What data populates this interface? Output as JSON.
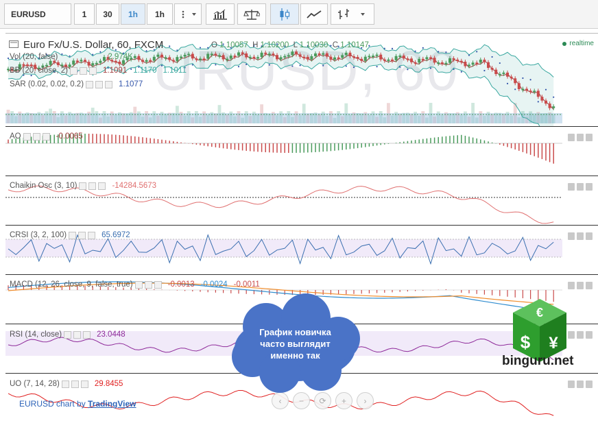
{
  "toolbar": {
    "symbol": "EURUSD",
    "intervals": [
      "1",
      "30",
      "1h",
      "1h"
    ],
    "active_interval_index": 2
  },
  "main": {
    "title": "Euro Fx/U.S. Dollar, 60, FXCM",
    "watermark": "URUSD, 60",
    "ohlc": {
      "o_label": "O",
      "o": "1.10057",
      "h_label": "H",
      "h": "1.10200",
      "l_label": "L",
      "l": "1.10030",
      "c_label": "C",
      "c": "1.10147"
    },
    "realtime": "realtime",
    "vol_label": "Vol (20, false)",
    "vol_value": "2.974K",
    "bb_label": "BB (20, close, 2)",
    "bb_values": [
      "1.1091",
      "1.1170",
      "1.1011"
    ],
    "sar_label": "SAR (0.02, 0.02, 0.2)",
    "sar_value": "1.1077"
  },
  "indicators": {
    "ao": {
      "label": "AO",
      "value": "-0.0065"
    },
    "chaikin": {
      "label": "Chaikin Osc (3, 10)",
      "value": "-14284.5673"
    },
    "crsi": {
      "label": "CRSI (3, 2, 100)",
      "value": "65.6972"
    },
    "macd": {
      "label": "MACD (12, 26, close, 9, false, true)",
      "values": [
        "-0.0013",
        "-0.0024",
        "-0.0011"
      ]
    },
    "rsi": {
      "label": "RSI (14, close)",
      "value": "23.0448"
    },
    "uo": {
      "label": "UO (7, 14, 28)",
      "value": "29.8455"
    }
  },
  "footer": {
    "prefix": "EURUSD chart by",
    "link": "TradingView"
  },
  "overlay": {
    "lines": [
      "График новичка",
      "часто выглядит",
      "именно так"
    ]
  },
  "logo": {
    "text": "binguru.net"
  },
  "colors": {
    "up": "#4a9a5c",
    "down": "#c94b4b",
    "bb": "#3aa8a0",
    "bb_basis": "#a03b3b",
    "sar": "#3355aa",
    "crsi": "#3b6fb0",
    "macd_line": "#2f8ccf",
    "macd_signal": "#f08c2a",
    "rsi": "#8e2a9a",
    "uo": "#e02020",
    "chaikin": "#e07070",
    "cloud": "#4a73c7",
    "logo": "#2e9e2e",
    "link": "#2d63b8"
  }
}
